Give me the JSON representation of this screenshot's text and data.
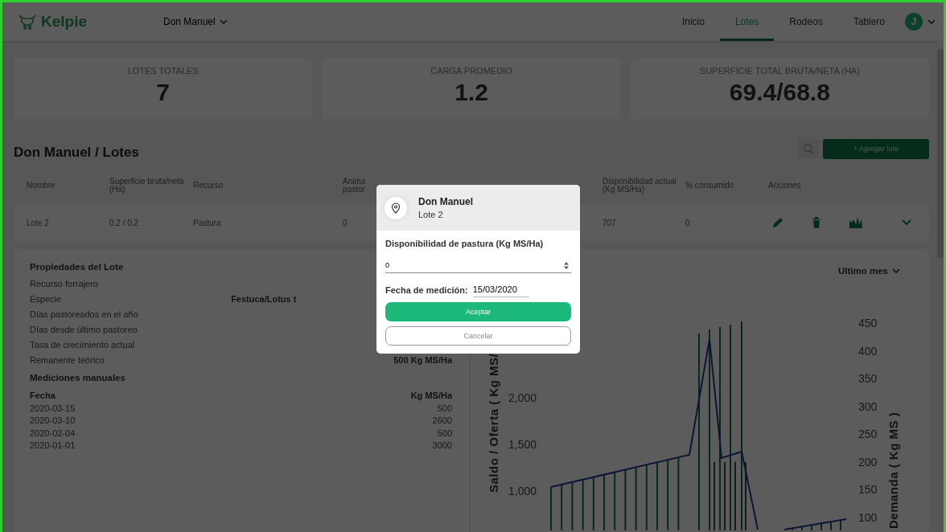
{
  "nav": {
    "logo": "Kelpie",
    "farm": "Don Manuel",
    "avatar": "J",
    "links": [
      {
        "label": "Inicio",
        "selected": false
      },
      {
        "label": "Lotes",
        "selected": true
      },
      {
        "label": "Rodeos",
        "selected": false
      },
      {
        "label": "Tablero",
        "selected": false
      }
    ]
  },
  "stats": [
    {
      "label": "LOTES TOTALES",
      "value": "7"
    },
    {
      "label": "CARGA PROMEDIO",
      "value": "1.2"
    },
    {
      "label": "SUPERFICIE TOTAL BRUTA/NETA (HA)",
      "value": "69.4/68.8"
    }
  ],
  "page_title": "Don Manuel / Lotes",
  "add_button": "+ Agregar lote",
  "table": {
    "columns": [
      "Nombre",
      "Superficie bruta/neta (Ha)",
      "Recurso",
      "Anima pastor",
      "Disponibilidad actual (Kg MS/Ha)",
      "% consumido",
      "Acciones"
    ],
    "rows": [
      {
        "cells": [
          "Lote 2",
          "0.2 / 0.2",
          "Pastura",
          "0",
          "707",
          "0"
        ]
      }
    ]
  },
  "props": {
    "title": "Propiedades del Lote",
    "rows": [
      {
        "label": "Recurso forrajero"
      },
      {
        "label": "Especie",
        "value": "Festuca/Lotus t",
        "covered": true
      },
      {
        "label": "Días pastoreados en el año"
      },
      {
        "label": "Días desde último pastoreo"
      },
      {
        "label": "Tasa de crecimiento actual"
      },
      {
        "label": "Remanente teórico",
        "value": "500 Kg MS/Ha"
      }
    ],
    "manual_title": "Mediciones manuales",
    "manual_columns": [
      "Fecha",
      "Kg MS/Ha"
    ],
    "manual_rows": [
      [
        "2020-03-15",
        "500"
      ],
      [
        "2020-03-10",
        "2600"
      ],
      [
        "2020-02-04",
        "500"
      ],
      [
        "2020-01-01",
        "3000"
      ]
    ]
  },
  "chart": {
    "period": "Ultimo mes",
    "left_label": "Saldo / Oferta ( Kg MS/",
    "left_ticks": [
      "2,000",
      "1,500",
      "1,000"
    ],
    "right_label": "Demanda ( Kg MS )",
    "right_ticks": [
      "450",
      "400",
      "350",
      "300",
      "250",
      "200",
      "150",
      "100"
    ]
  },
  "modal": {
    "farm": "Don Manuel",
    "lot": "Lote 2",
    "field_label": "Disponibilidad de pastura (Kg MS/Ha)",
    "value": "0",
    "date_label": "Fecha de medición:",
    "date": "15/03/2020",
    "accept": "Aceptar",
    "cancel": "Cancelar"
  }
}
